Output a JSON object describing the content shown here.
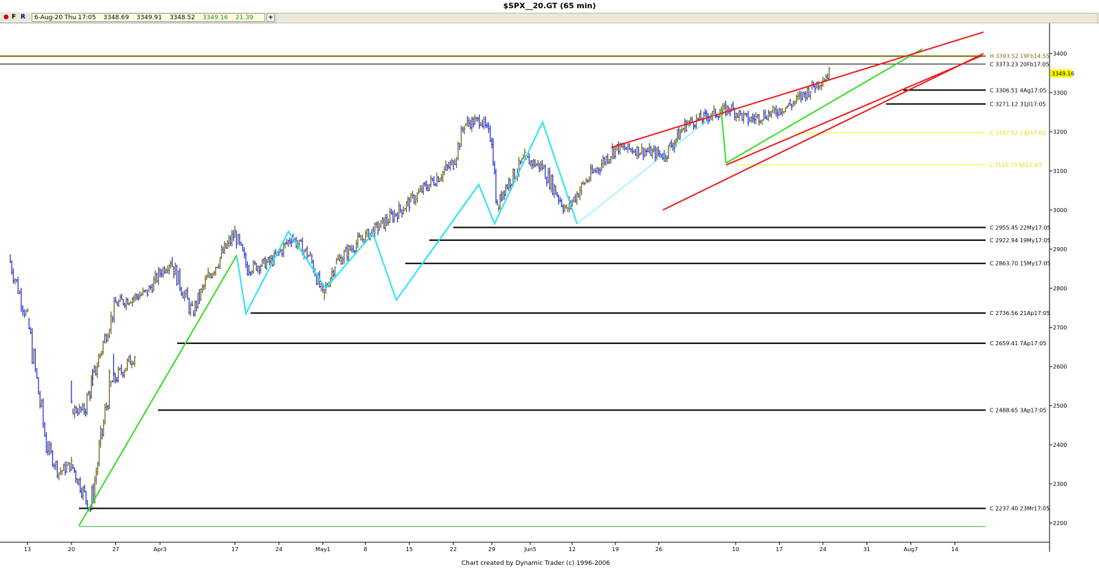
{
  "window": {
    "title": "$SPX__20.GT (65 min)"
  },
  "toolbar": {
    "dot_icon": "red-dot-icon",
    "f_label": "F",
    "r_label": "R",
    "date_time": "6-Aug-20 Thu 17:05",
    "open": "3348.69",
    "high": "3349.91",
    "low": "3348.52",
    "close": "3349.16",
    "change": "21.39",
    "add_label": "+"
  },
  "footer": "Chart created by Dynamic Trader  (c) 1996-2006",
  "colors": {
    "up_bar": "#6b6118",
    "down_bar": "#1f2fe0",
    "trend_green": "#33dd22",
    "trend_red": "#ee1b1b",
    "zigzag_cyan": "#33e3f0",
    "yellow_level": "#ffff00",
    "high_level": "#7a6a00",
    "last_price_bg": "#ffff00"
  },
  "chart_data": {
    "type": "line",
    "title": "$SPX__20.GT (65 min)",
    "ylim": [
      2180,
      3470
    ],
    "y_ticks": [
      2200,
      2300,
      2400,
      2500,
      2600,
      2700,
      2800,
      2900,
      3000,
      3100,
      3200,
      3300,
      3400
    ],
    "x_ticks": [
      "13",
      "20",
      "27",
      "Apr3",
      "17",
      "24",
      "May1",
      "8",
      "15",
      "22",
      "29",
      "Jun5",
      "12",
      "19",
      "26",
      "10",
      "17",
      "24",
      "31",
      "Aug7",
      "14"
    ],
    "last_price": "3349.16",
    "series": [
      {
        "name": "",
        "x": [
          "Mar10",
          "Mar13",
          "Mar16",
          "Mar18",
          "Mar20",
          "Mar23",
          "Mar26",
          "Mar30",
          "Apr1",
          "Apr3",
          "Apr6",
          "Apr8",
          "Apr13",
          "Apr15",
          "Apr17",
          "Apr21",
          "Apr24",
          "Apr29",
          "May1",
          "May5",
          "May8",
          "May11",
          "May13",
          "May15",
          "May19",
          "May22",
          "May27",
          "May29",
          "Jun3",
          "Jun5",
          "Jun8",
          "Jun10",
          "Jun11",
          "Jun12",
          "Jun16",
          "Jun19",
          "Jun23",
          "Jun26",
          "Jul1",
          "Jul6",
          "Jul9",
          "Jul13",
          "Jul17",
          "Jul21",
          "Jul24",
          "Jul28",
          "Jul31",
          "Aug3",
          "Aug6"
        ],
        "close": [
          2880,
          2720,
          2400,
          2330,
          2350,
          2237,
          2550,
          2630,
          2490,
          2488,
          2660,
          2760,
          2790,
          2840,
          2870,
          2736,
          2830,
          2940,
          2850,
          2870,
          2930,
          2880,
          2780,
          2863,
          2922,
          2955,
          3020,
          3050,
          3120,
          3220,
          3230,
          3180,
          3000,
          3050,
          3130,
          3110,
          3000,
          3070,
          3160,
          3150,
          3140,
          3220,
          3240,
          3260,
          3230,
          3250,
          3270,
          3310,
          3349
        ]
      }
    ],
    "levels": [
      {
        "label": "H 3393.52 19Fb14:55",
        "value": 3393.52,
        "color": "#7a6a00"
      },
      {
        "label": "C 3373.23 20Fb17:05",
        "value": 3373.23,
        "color": "#000000"
      },
      {
        "label": "C 3306.51 4Ag17:05",
        "value": 3306.51,
        "color": "#000000"
      },
      {
        "label": "C 3271.12 31Jl17:05",
        "value": 3271.12,
        "color": "#000000"
      },
      {
        "label": "C 3197.52 14Jl17:05",
        "value": 3197.52,
        "color": "#ffff00"
      },
      {
        "label": "L 3115.73 9Jl11:43",
        "value": 3115.73,
        "color": "#ffff00"
      },
      {
        "label": "C 2955.45 22My17:05",
        "value": 2955.45,
        "color": "#000000"
      },
      {
        "label": "C 2922.94 19My17:05",
        "value": 2922.94,
        "color": "#000000"
      },
      {
        "label": "C 2863.70 15My17:05",
        "value": 2863.7,
        "color": "#000000"
      },
      {
        "label": "C 2736.56 21Ap17:05",
        "value": 2736.56,
        "color": "#000000"
      },
      {
        "label": "C 2659.41 7Ap17:05",
        "value": 2659.41,
        "color": "#000000"
      },
      {
        "label": "C 2488.65 3Ap17:05",
        "value": 2488.65,
        "color": "#000000"
      },
      {
        "label": "C 2237.40 23Mr17:05",
        "value": 2237.4,
        "color": "#000000"
      }
    ],
    "grid": false,
    "legend": "none"
  }
}
